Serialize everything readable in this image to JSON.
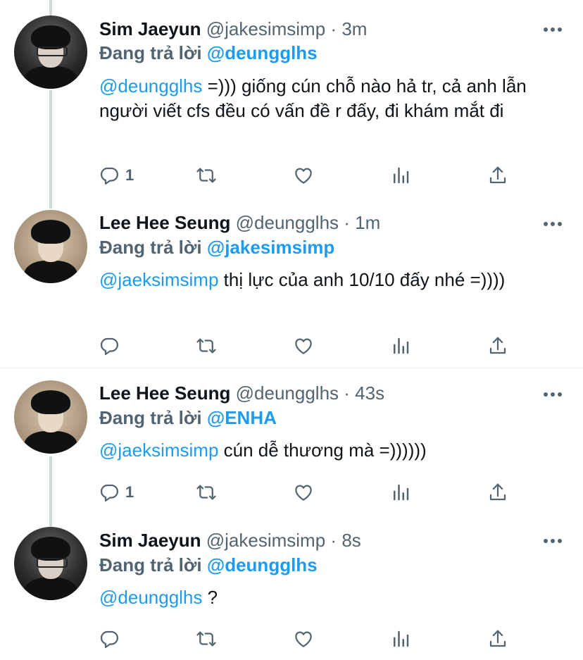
{
  "tweets": [
    {
      "name": "Sim Jaeyun",
      "handle": "@jakesimsimp",
      "time": "3m",
      "reply_prefix": "Đang trả lời",
      "reply_to": "@deungglhs",
      "mention": "@deungglhs",
      "text": " =))) giống cún chỗ nào hả tr, cả anh lẫn người viết cfs đều có vấn đề r đấy, đi khám mắt đi",
      "reply_count": "1"
    },
    {
      "name": "Lee Hee Seung",
      "handle": "@deungglhs",
      "time": "1m",
      "reply_prefix": "Đang trả lời",
      "reply_to": "@jakesimsimp",
      "mention": "@jaeksimsimp",
      "text": " thị lực của anh 10/10 đấy nhé =))))",
      "reply_count": ""
    },
    {
      "name": "Lee Hee Seung",
      "handle": "@deungglhs",
      "time": "43s",
      "reply_prefix": "Đang trả lời",
      "reply_to": "@ENHA",
      "mention": "@jaeksimsimp",
      "text": " cún dễ thương mà =))))))",
      "reply_count": "1"
    },
    {
      "name": "Sim Jaeyun",
      "handle": "@jakesimsimp",
      "time": "8s",
      "reply_prefix": "Đang trả lời",
      "reply_to": "@deungglhs",
      "mention": "@deungglhs",
      "text": " ?",
      "reply_count": ""
    }
  ],
  "separator": "·",
  "colors": {
    "accent": "#1d9bf0",
    "muted": "#536471",
    "text": "#0f1419",
    "thread_line": "#cfd9de"
  },
  "icons": [
    "reply-icon",
    "retweet-icon",
    "like-icon",
    "analytics-icon",
    "share-icon",
    "more-icon"
  ]
}
